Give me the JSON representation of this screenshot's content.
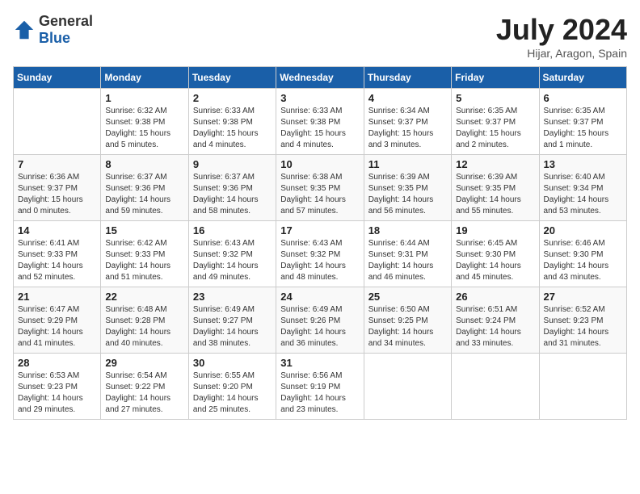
{
  "header": {
    "logo_general": "General",
    "logo_blue": "Blue",
    "month_title": "July 2024",
    "location": "Hijar, Aragon, Spain"
  },
  "weekdays": [
    "Sunday",
    "Monday",
    "Tuesday",
    "Wednesday",
    "Thursday",
    "Friday",
    "Saturday"
  ],
  "weeks": [
    [
      {
        "day": "",
        "sunrise": "",
        "sunset": "",
        "daylight": ""
      },
      {
        "day": "1",
        "sunrise": "Sunrise: 6:32 AM",
        "sunset": "Sunset: 9:38 PM",
        "daylight": "Daylight: 15 hours and 5 minutes."
      },
      {
        "day": "2",
        "sunrise": "Sunrise: 6:33 AM",
        "sunset": "Sunset: 9:38 PM",
        "daylight": "Daylight: 15 hours and 4 minutes."
      },
      {
        "day": "3",
        "sunrise": "Sunrise: 6:33 AM",
        "sunset": "Sunset: 9:38 PM",
        "daylight": "Daylight: 15 hours and 4 minutes."
      },
      {
        "day": "4",
        "sunrise": "Sunrise: 6:34 AM",
        "sunset": "Sunset: 9:37 PM",
        "daylight": "Daylight: 15 hours and 3 minutes."
      },
      {
        "day": "5",
        "sunrise": "Sunrise: 6:35 AM",
        "sunset": "Sunset: 9:37 PM",
        "daylight": "Daylight: 15 hours and 2 minutes."
      },
      {
        "day": "6",
        "sunrise": "Sunrise: 6:35 AM",
        "sunset": "Sunset: 9:37 PM",
        "daylight": "Daylight: 15 hours and 1 minute."
      }
    ],
    [
      {
        "day": "7",
        "sunrise": "Sunrise: 6:36 AM",
        "sunset": "Sunset: 9:37 PM",
        "daylight": "Daylight: 15 hours and 0 minutes."
      },
      {
        "day": "8",
        "sunrise": "Sunrise: 6:37 AM",
        "sunset": "Sunset: 9:36 PM",
        "daylight": "Daylight: 14 hours and 59 minutes."
      },
      {
        "day": "9",
        "sunrise": "Sunrise: 6:37 AM",
        "sunset": "Sunset: 9:36 PM",
        "daylight": "Daylight: 14 hours and 58 minutes."
      },
      {
        "day": "10",
        "sunrise": "Sunrise: 6:38 AM",
        "sunset": "Sunset: 9:35 PM",
        "daylight": "Daylight: 14 hours and 57 minutes."
      },
      {
        "day": "11",
        "sunrise": "Sunrise: 6:39 AM",
        "sunset": "Sunset: 9:35 PM",
        "daylight": "Daylight: 14 hours and 56 minutes."
      },
      {
        "day": "12",
        "sunrise": "Sunrise: 6:39 AM",
        "sunset": "Sunset: 9:35 PM",
        "daylight": "Daylight: 14 hours and 55 minutes."
      },
      {
        "day": "13",
        "sunrise": "Sunrise: 6:40 AM",
        "sunset": "Sunset: 9:34 PM",
        "daylight": "Daylight: 14 hours and 53 minutes."
      }
    ],
    [
      {
        "day": "14",
        "sunrise": "Sunrise: 6:41 AM",
        "sunset": "Sunset: 9:33 PM",
        "daylight": "Daylight: 14 hours and 52 minutes."
      },
      {
        "day": "15",
        "sunrise": "Sunrise: 6:42 AM",
        "sunset": "Sunset: 9:33 PM",
        "daylight": "Daylight: 14 hours and 51 minutes."
      },
      {
        "day": "16",
        "sunrise": "Sunrise: 6:43 AM",
        "sunset": "Sunset: 9:32 PM",
        "daylight": "Daylight: 14 hours and 49 minutes."
      },
      {
        "day": "17",
        "sunrise": "Sunrise: 6:43 AM",
        "sunset": "Sunset: 9:32 PM",
        "daylight": "Daylight: 14 hours and 48 minutes."
      },
      {
        "day": "18",
        "sunrise": "Sunrise: 6:44 AM",
        "sunset": "Sunset: 9:31 PM",
        "daylight": "Daylight: 14 hours and 46 minutes."
      },
      {
        "day": "19",
        "sunrise": "Sunrise: 6:45 AM",
        "sunset": "Sunset: 9:30 PM",
        "daylight": "Daylight: 14 hours and 45 minutes."
      },
      {
        "day": "20",
        "sunrise": "Sunrise: 6:46 AM",
        "sunset": "Sunset: 9:30 PM",
        "daylight": "Daylight: 14 hours and 43 minutes."
      }
    ],
    [
      {
        "day": "21",
        "sunrise": "Sunrise: 6:47 AM",
        "sunset": "Sunset: 9:29 PM",
        "daylight": "Daylight: 14 hours and 41 minutes."
      },
      {
        "day": "22",
        "sunrise": "Sunrise: 6:48 AM",
        "sunset": "Sunset: 9:28 PM",
        "daylight": "Daylight: 14 hours and 40 minutes."
      },
      {
        "day": "23",
        "sunrise": "Sunrise: 6:49 AM",
        "sunset": "Sunset: 9:27 PM",
        "daylight": "Daylight: 14 hours and 38 minutes."
      },
      {
        "day": "24",
        "sunrise": "Sunrise: 6:49 AM",
        "sunset": "Sunset: 9:26 PM",
        "daylight": "Daylight: 14 hours and 36 minutes."
      },
      {
        "day": "25",
        "sunrise": "Sunrise: 6:50 AM",
        "sunset": "Sunset: 9:25 PM",
        "daylight": "Daylight: 14 hours and 34 minutes."
      },
      {
        "day": "26",
        "sunrise": "Sunrise: 6:51 AM",
        "sunset": "Sunset: 9:24 PM",
        "daylight": "Daylight: 14 hours and 33 minutes."
      },
      {
        "day": "27",
        "sunrise": "Sunrise: 6:52 AM",
        "sunset": "Sunset: 9:23 PM",
        "daylight": "Daylight: 14 hours and 31 minutes."
      }
    ],
    [
      {
        "day": "28",
        "sunrise": "Sunrise: 6:53 AM",
        "sunset": "Sunset: 9:23 PM",
        "daylight": "Daylight: 14 hours and 29 minutes."
      },
      {
        "day": "29",
        "sunrise": "Sunrise: 6:54 AM",
        "sunset": "Sunset: 9:22 PM",
        "daylight": "Daylight: 14 hours and 27 minutes."
      },
      {
        "day": "30",
        "sunrise": "Sunrise: 6:55 AM",
        "sunset": "Sunset: 9:20 PM",
        "daylight": "Daylight: 14 hours and 25 minutes."
      },
      {
        "day": "31",
        "sunrise": "Sunrise: 6:56 AM",
        "sunset": "Sunset: 9:19 PM",
        "daylight": "Daylight: 14 hours and 23 minutes."
      },
      {
        "day": "",
        "sunrise": "",
        "sunset": "",
        "daylight": ""
      },
      {
        "day": "",
        "sunrise": "",
        "sunset": "",
        "daylight": ""
      },
      {
        "day": "",
        "sunrise": "",
        "sunset": "",
        "daylight": ""
      }
    ]
  ]
}
